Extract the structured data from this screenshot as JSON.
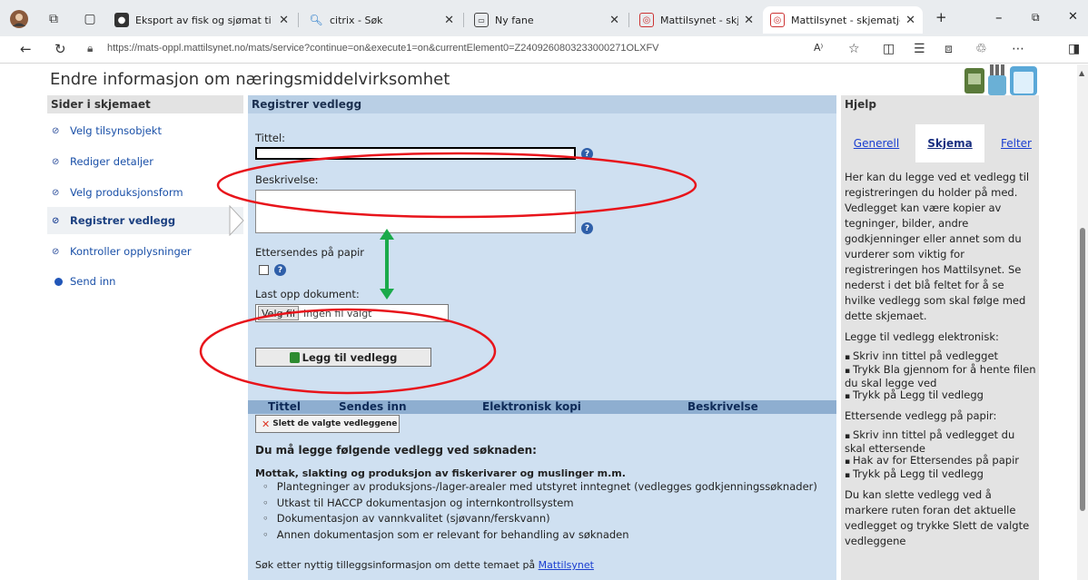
{
  "browser": {
    "tabs": [
      {
        "title": "Eksport av fisk og sjømat ti",
        "icon": "leaf-icon"
      },
      {
        "title": "citrix - Søk",
        "icon": "search-icon"
      },
      {
        "title": "Ny fane",
        "icon": "newtab-icon"
      },
      {
        "title": "Mattilsynet - skjematjenest",
        "icon": "mattilsynet-icon"
      },
      {
        "title": "Mattilsynet - skjematjenest",
        "icon": "mattilsynet-icon"
      }
    ],
    "url": "https://mats-oppl.mattilsynet.no/mats/service?continue=on&execute1=on&currentElement0=Z2409260803233000271OLXFV"
  },
  "page": {
    "title": "Endre informasjon om næringsmiddelvirksomhet"
  },
  "sidebar": {
    "heading": "Sider i skjemaet",
    "items": [
      {
        "label": "Velg tilsynsobjekt"
      },
      {
        "label": "Rediger detaljer"
      },
      {
        "label": "Velg produksjonsform"
      },
      {
        "label": "Registrer vedlegg"
      },
      {
        "label": "Kontroller opplysninger"
      },
      {
        "label": "Send inn"
      }
    ]
  },
  "main": {
    "heading": "Registrer vedlegg",
    "title_label": "Tittel:",
    "title_value": "",
    "description_label": "Beskrivelse:",
    "description_value": "",
    "paper_label": "Ettersendes på papir",
    "upload_label": "Last opp dokument:",
    "file_button": "Velg fil",
    "file_status": "Ingen fil valgt",
    "add_button": "Legg til vedlegg",
    "table_headers": [
      "Tittel",
      "Sendes inn",
      "Elektronisk kopi",
      "Beskrivelse"
    ],
    "delete_button": "Slett de valgte vedleggene",
    "required_title": "Du må legge følgende vedlegg ved søknaden:",
    "required_subtitle": "Mottak, slakting og produksjon av fiskerivarer og muslinger m.m.",
    "required_items": [
      "Plantegninger av produksjons-/lager-arealer med utstyret inntegnet (vedlegges godkjenningssøknader)",
      "Utkast til HACCP dokumentasjon og internkontrollsystem",
      "Dokumentasjon av vannkvalitet (sjøvann/ferskvann)",
      "Annen dokumentasjon som er relevant for behandling av søknaden"
    ],
    "more_info_prefix": "Søk etter nyttig tilleggsinformasjon om dette temaet på",
    "more_info_link": "Mattilsynet"
  },
  "help": {
    "heading": "Hjelp",
    "tabs": [
      "Generell",
      "Skjema",
      "Felter"
    ],
    "intro": "Her kan du legge ved et vedlegg til registreringen du holder på med. Vedlegget kan være kopier av tegninger, bilder, andre godkjenninger eller annet som du vurderer som viktig for registreringen hos Mattilsynet. Se nederst i det blå feltet for å se hvilke vedlegg som skal følge med dette skjemaet.",
    "electronic_heading": "Legge til vedlegg elektronisk:",
    "electronic_steps": [
      "Skriv inn tittel på vedlegget",
      "Trykk Bla gjennom for å hente filen du skal legge ved",
      "Trykk på Legg til vedlegg"
    ],
    "paper_heading": "Ettersende vedlegg på papir:",
    "paper_steps": [
      "Skriv inn tittel på vedlegget du skal ettersende",
      "Hak av for Ettersendes på papir",
      "Trykk på Legg til vedlegg"
    ],
    "delete_text": "Du kan slette vedlegg ved å markere ruten foran det aktuelle vedlegget og trykke Slett de valgte vedleggene"
  },
  "annotations": {
    "ellipse_color": "#e8141b",
    "arrow_color": "#1aaa4a"
  }
}
